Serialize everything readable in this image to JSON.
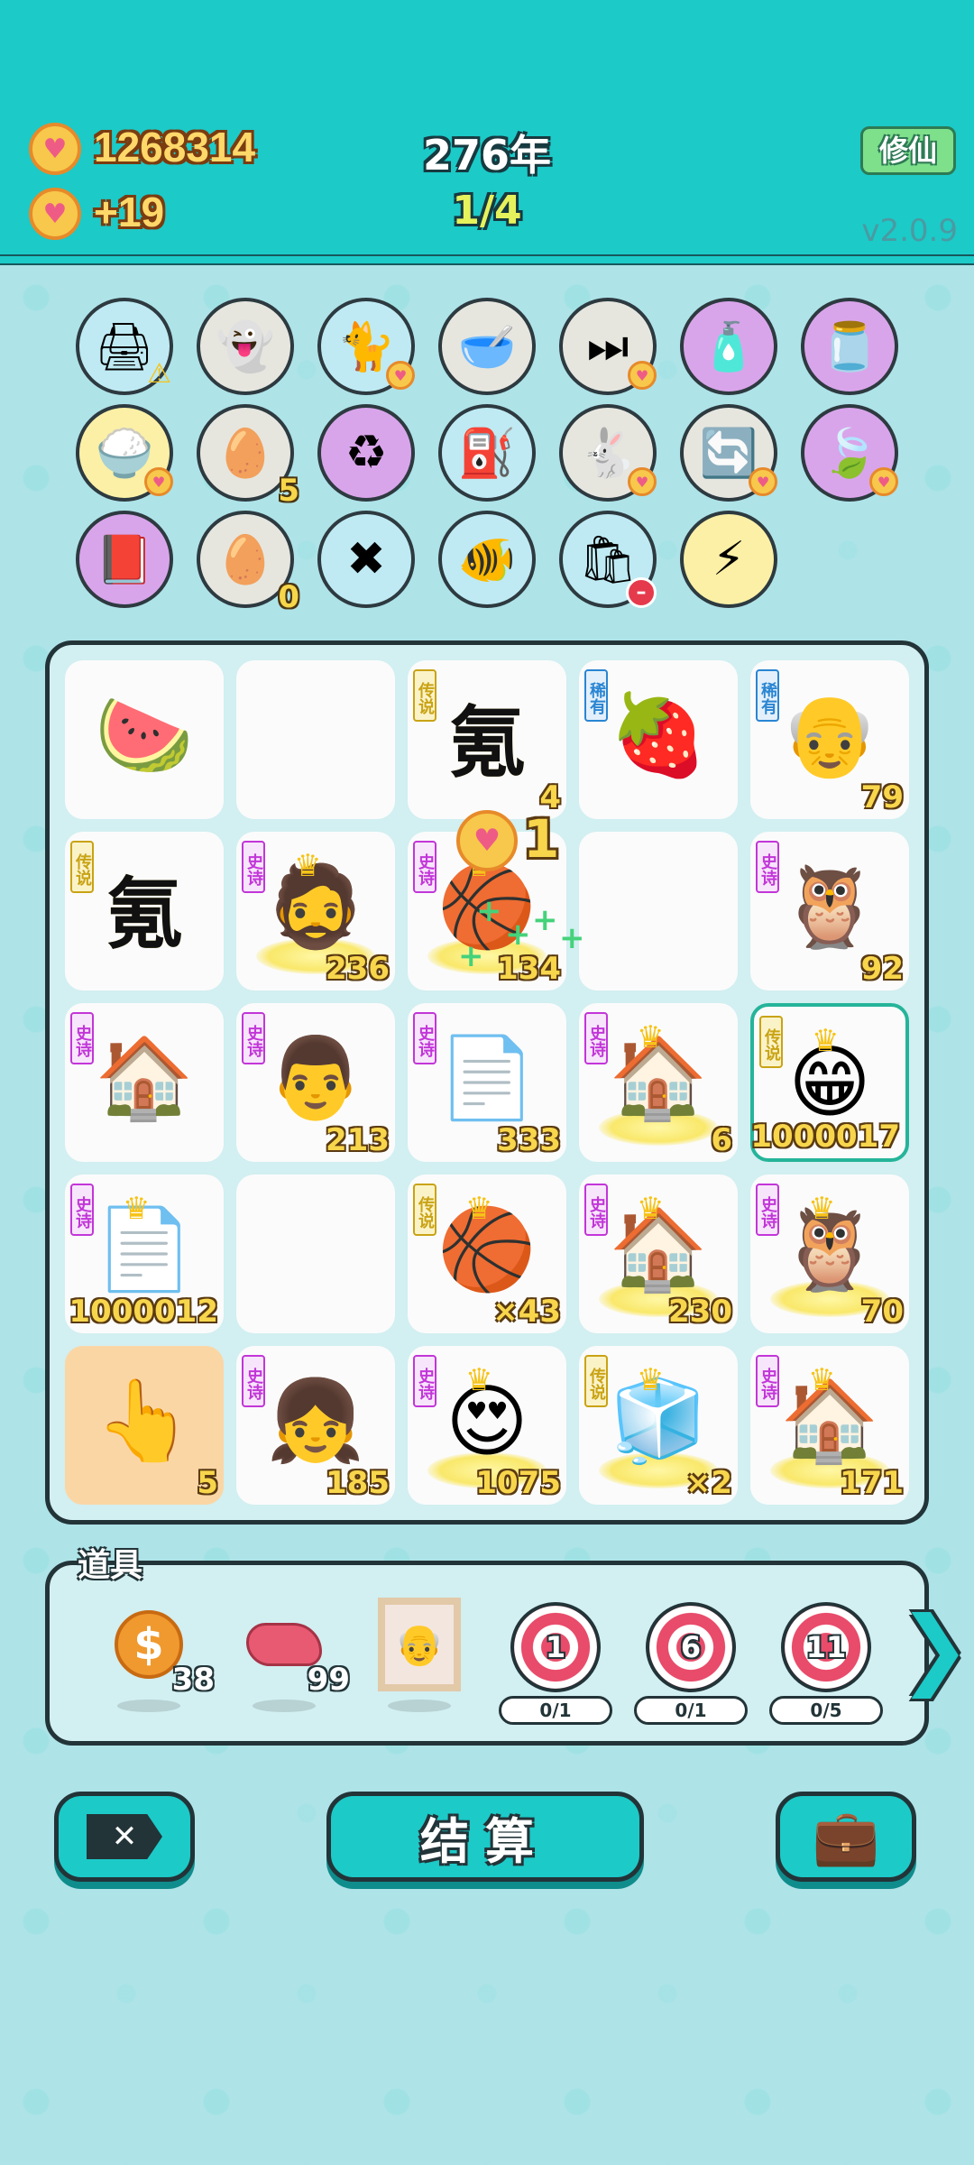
{
  "header": {
    "coins": "1268314",
    "income": "+19",
    "year": "276年",
    "progress": "1/4",
    "mode_button": "修仙",
    "version": "v2.0.9"
  },
  "icons_row1": [
    {
      "name": "printer",
      "glyph": "🖨",
      "bg": "#bfeaf3",
      "badge": "warn"
    },
    {
      "name": "ghost",
      "glyph": "👻",
      "bg": "#e6e6df",
      "badge": ""
    },
    {
      "name": "cat",
      "glyph": "🐈",
      "bg": "#bfeaf3",
      "badge": "heart"
    },
    {
      "name": "pet-bowl",
      "glyph": "🥣",
      "bg": "#e6e6df",
      "badge": ""
    },
    {
      "name": "skip",
      "glyph": "⏭",
      "bg": "#e6e6df",
      "badge": "heart"
    },
    {
      "name": "spray-bottle",
      "glyph": "🧴",
      "bg": "#d9a5ea",
      "badge": ""
    },
    {
      "name": "jar",
      "glyph": "🫙",
      "bg": "#d9a5ea",
      "badge": ""
    }
  ],
  "icons_row2": [
    {
      "name": "rice-bowl",
      "glyph": "🍚",
      "bg": "#fbf0a6",
      "badge": "heart",
      "count": ""
    },
    {
      "name": "egg-tray",
      "glyph": "🥚",
      "bg": "#e6e6df",
      "badge": "",
      "count": "5"
    },
    {
      "name": "recycle",
      "glyph": "♻",
      "bg": "#d9a5ea",
      "badge": "",
      "count": ""
    },
    {
      "name": "pump",
      "glyph": "⛽",
      "bg": "#bfeaf3",
      "badge": "",
      "count": ""
    },
    {
      "name": "rabbit",
      "glyph": "🐇",
      "bg": "#e6e6df",
      "badge": "heart",
      "count": ""
    },
    {
      "name": "refresh",
      "glyph": "🔄",
      "bg": "#e6e6df",
      "badge": "heart",
      "count": ""
    },
    {
      "name": "leaf",
      "glyph": "🍃",
      "bg": "#d9a5ea",
      "badge": "heart",
      "count": ""
    }
  ],
  "icons_row3": [
    {
      "name": "time-magazine",
      "glyph": "📕",
      "bg": "#d9a5ea",
      "badge": "",
      "count": ""
    },
    {
      "name": "egg-tray-empty",
      "glyph": "🥚",
      "bg": "#e6e6df",
      "badge": "",
      "count": "0"
    },
    {
      "name": "chopsticks",
      "glyph": "✖",
      "bg": "#bfeaf3",
      "badge": "",
      "count": ""
    },
    {
      "name": "fish-tank",
      "glyph": "🐠",
      "bg": "#bfeaf3",
      "badge": "",
      "count": ""
    },
    {
      "name": "trash-bag",
      "glyph": "🛍",
      "bg": "#bfeaf3",
      "badge": "no",
      "count": ""
    },
    {
      "name": "lightning",
      "glyph": "⚡",
      "bg": "#fbf0a6",
      "badge": "",
      "count": ""
    }
  ],
  "board": [
    [
      {
        "name": "watermelon",
        "glyph": "🍉",
        "rarity": "",
        "count": ""
      },
      {
        "name": "empty",
        "glyph": "",
        "rarity": "",
        "count": ""
      },
      {
        "name": "qi-char",
        "glyph": "氪",
        "rarity": "传说",
        "count": "4",
        "qi": true
      },
      {
        "name": "lychee",
        "glyph": "🍓",
        "rarity": "稀有",
        "count": ""
      },
      {
        "name": "bald-man",
        "glyph": "👴",
        "rarity": "稀有",
        "count": "79"
      }
    ],
    [
      {
        "name": "qi-char",
        "glyph": "氪",
        "rarity": "传说",
        "count": "",
        "qi": true
      },
      {
        "name": "bearded-king",
        "glyph": "🧔",
        "rarity": "史诗",
        "count": "236",
        "aura": true,
        "crown": true
      },
      {
        "name": "bearded-king-basketball",
        "glyph": "🏀",
        "rarity": "史诗",
        "count": "134",
        "aura": true,
        "crown": true
      },
      {
        "name": "empty",
        "glyph": "",
        "rarity": "",
        "count": ""
      },
      {
        "name": "old-owl",
        "glyph": "🦉",
        "rarity": "史诗",
        "count": "92"
      }
    ],
    [
      {
        "name": "rabbit-house",
        "glyph": "🏠",
        "rarity": "史诗",
        "count": ""
      },
      {
        "name": "old-man-face",
        "glyph": "👨",
        "rarity": "史诗",
        "count": "213"
      },
      {
        "name": "ctrl-c-ctrl-v",
        "glyph": "📄",
        "rarity": "史诗",
        "count": "333"
      },
      {
        "name": "rabbit-house-king",
        "glyph": "🏠",
        "rarity": "史诗",
        "count": "6",
        "aura": true,
        "crown": true
      },
      {
        "name": "grinning-king",
        "glyph": "😁",
        "rarity": "传说",
        "count": "1000017",
        "crown": true,
        "active": true
      }
    ],
    [
      {
        "name": "ctrl-c-ctrl-v-king",
        "glyph": "📄",
        "rarity": "史诗",
        "count": "1000012",
        "crown": true
      },
      {
        "name": "empty",
        "glyph": "",
        "rarity": "",
        "count": ""
      },
      {
        "name": "basketball-king",
        "glyph": "🏀",
        "rarity": "传说",
        "count": "×43",
        "crown": true
      },
      {
        "name": "rabbit-house-king",
        "glyph": "🏠",
        "rarity": "史诗",
        "count": "230",
        "aura": true,
        "crown": true
      },
      {
        "name": "owl-king",
        "glyph": "🦉",
        "rarity": "史诗",
        "count": "70",
        "aura": true,
        "crown": true
      }
    ],
    [
      {
        "name": "pointing-hand",
        "glyph": "👆",
        "rarity": "",
        "count": "5",
        "hand": true
      },
      {
        "name": "braided-girl",
        "glyph": "👧",
        "rarity": "史诗",
        "count": "185"
      },
      {
        "name": "love-bearded-king",
        "glyph": "😍",
        "rarity": "史诗",
        "count": "1075",
        "aura": true,
        "crown": true
      },
      {
        "name": "fridge-king",
        "glyph": "🧊",
        "rarity": "传说",
        "count": "×2",
        "aura": true,
        "crown": true
      },
      {
        "name": "rabbit-house-king",
        "glyph": "🏠",
        "rarity": "史诗",
        "count": "171",
        "aura": true,
        "crown": true
      }
    ]
  ],
  "effect": {
    "value": "1"
  },
  "props": {
    "title": "道具",
    "items": [
      {
        "name": "coin-token",
        "glyph": "💲",
        "count": "38"
      },
      {
        "name": "liver",
        "glyph": "🫀",
        "count": "99"
      },
      {
        "name": "portrait-frame",
        "glyph": "🖼",
        "count": ""
      }
    ],
    "targets": [
      {
        "label": "1",
        "progress": "0/1"
      },
      {
        "label": "6",
        "progress": "0/1"
      },
      {
        "label": "11",
        "progress": "0/5"
      }
    ]
  },
  "buttons": {
    "exit": "✕",
    "settle": "结算",
    "bag": "💼"
  },
  "colors": {
    "header": "#1ccac8",
    "background": "#aee3e8",
    "board": "#d2eff1",
    "outline": "#223438"
  }
}
